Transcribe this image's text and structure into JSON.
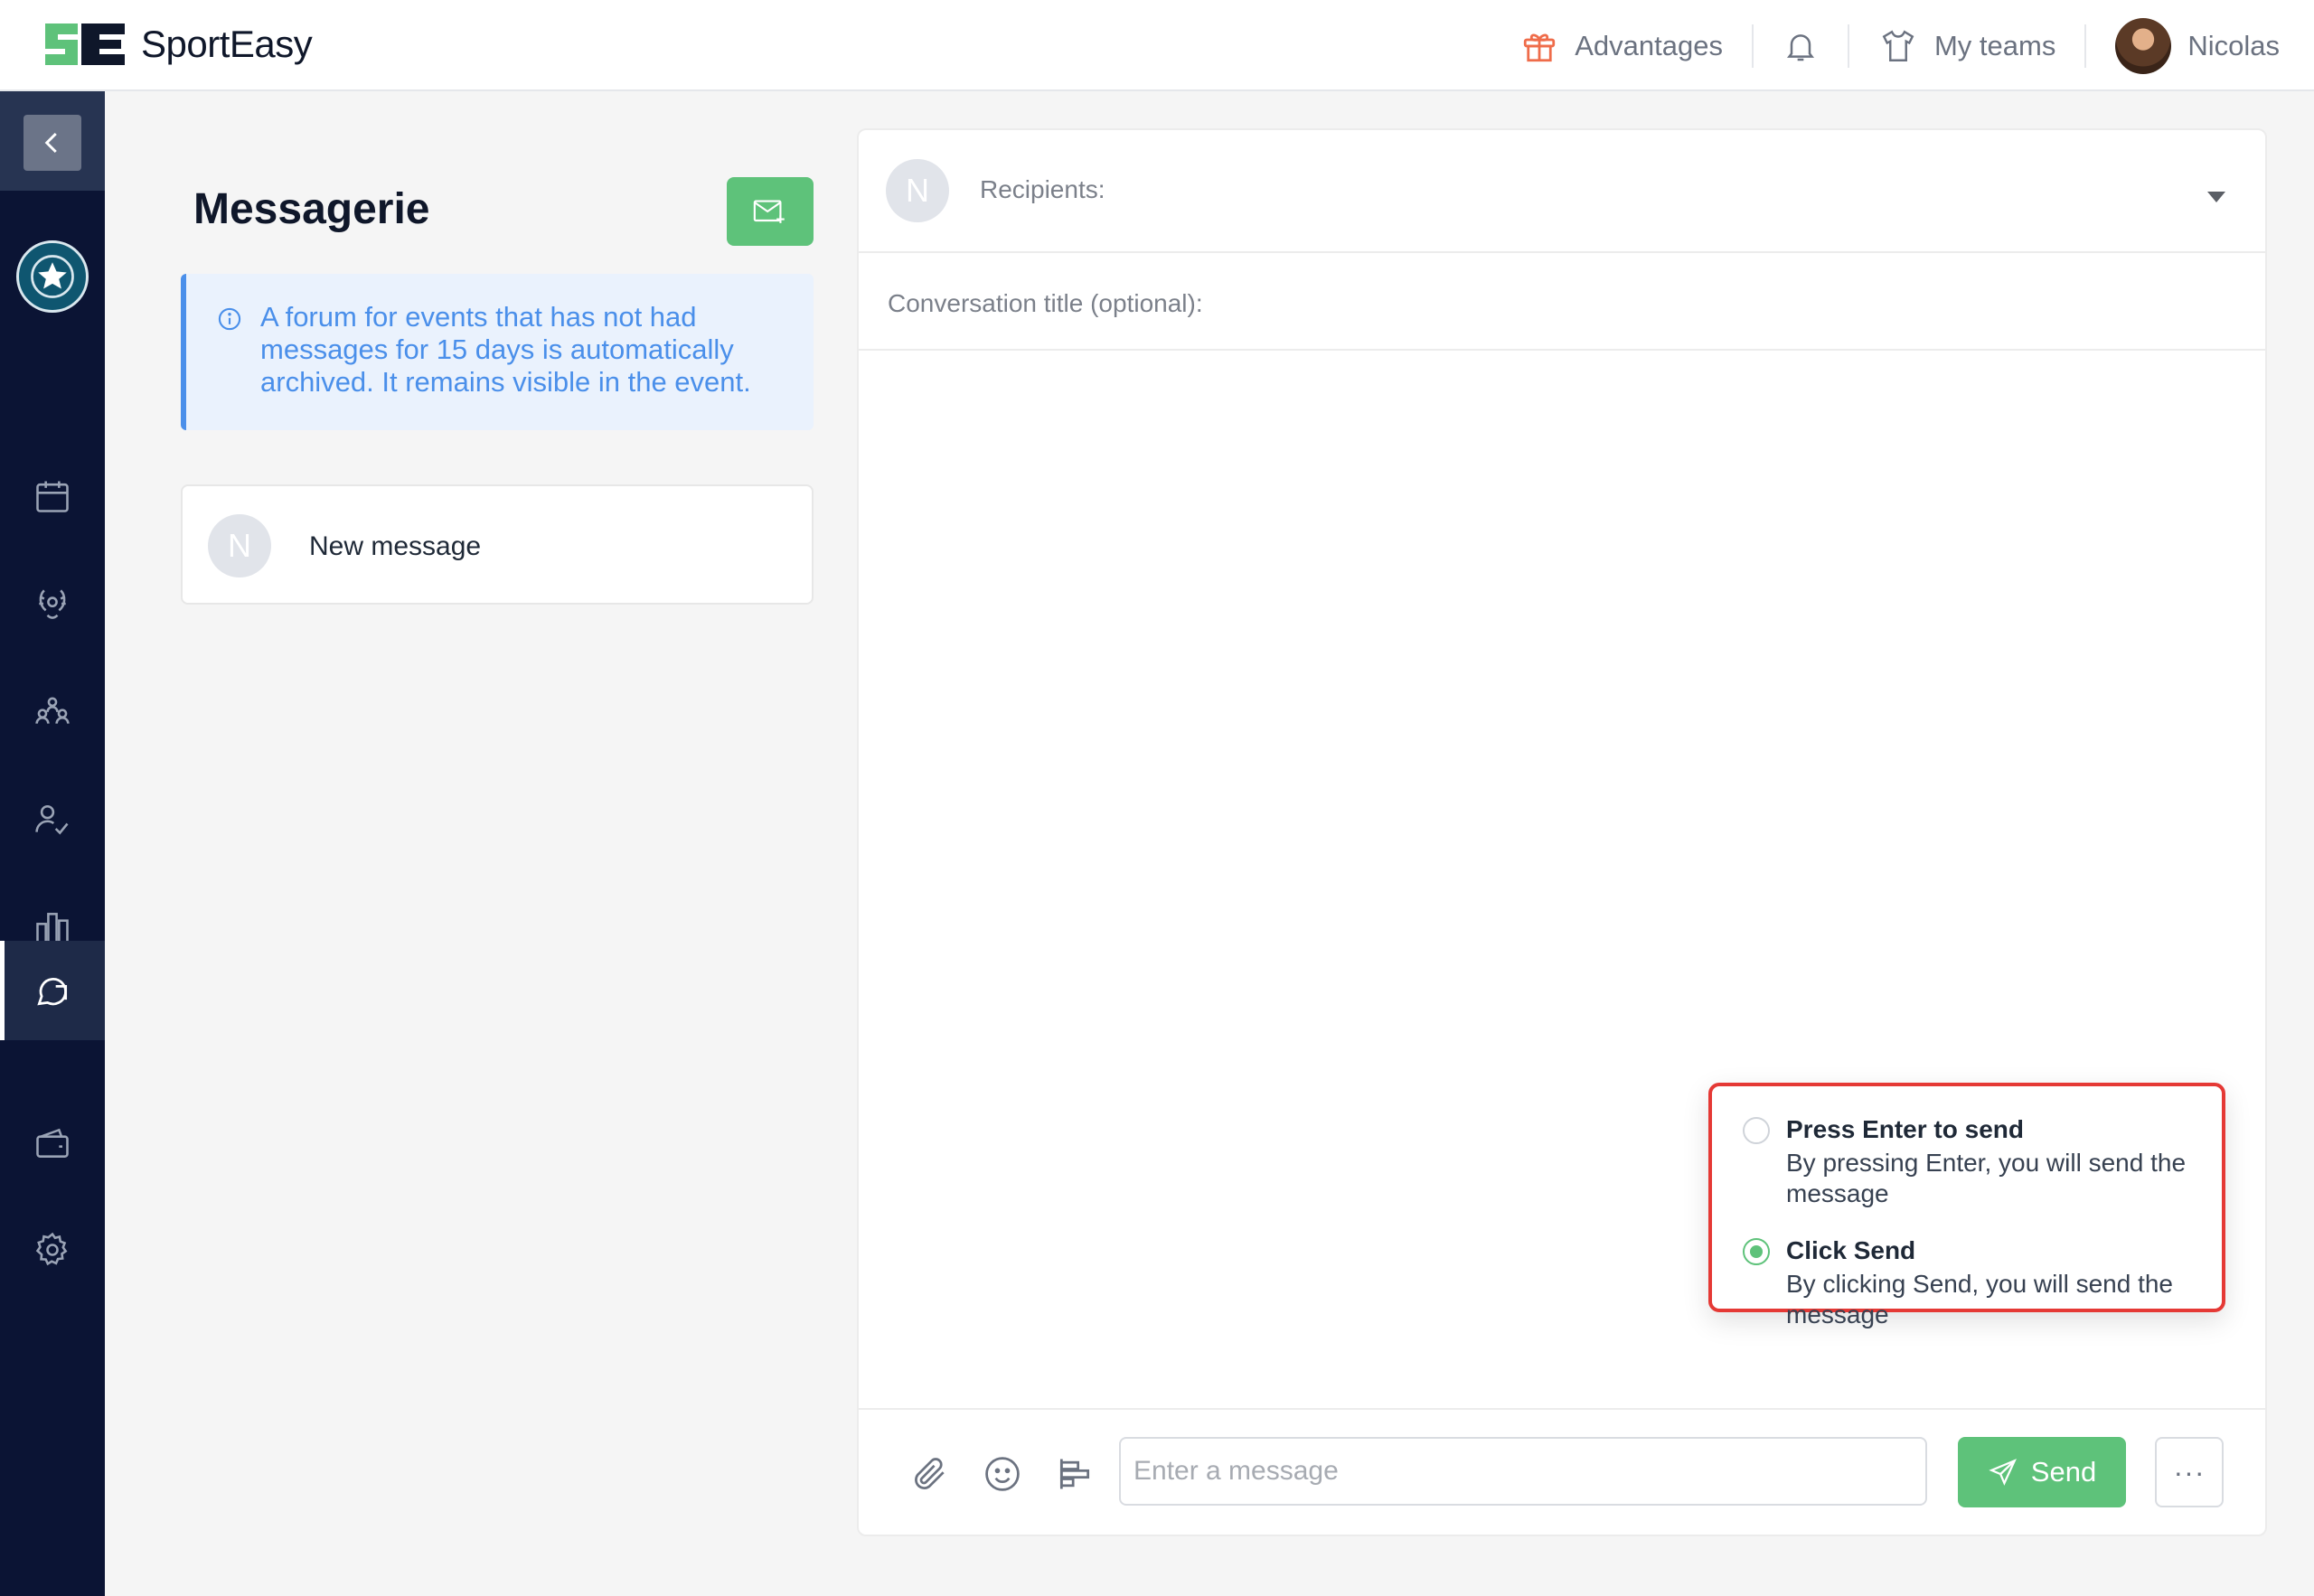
{
  "brand": {
    "name_part1": "Sport",
    "name_part2": "Easy",
    "logo_icon": "sporteasy-logo-icon"
  },
  "topbar": {
    "advantages_label": "Advantages",
    "my_teams_label": "My teams",
    "user_name": "Nicolas",
    "icons": [
      "gift-icon",
      "bell-icon",
      "tshirt-icon",
      "user-avatar"
    ]
  },
  "sidebar": {
    "items": [
      {
        "icon": "calendar-icon"
      },
      {
        "icon": "laurel-trophy-icon"
      },
      {
        "icon": "team-members-icon"
      },
      {
        "icon": "attendance-check-icon"
      },
      {
        "icon": "statistics-icon"
      },
      {
        "icon": "messages-icon",
        "active": true
      },
      {
        "icon": "wallet-icon"
      },
      {
        "icon": "settings-gear-icon"
      }
    ],
    "club_logo": "olympiens-club-logo"
  },
  "messaging": {
    "title": "Messagerie",
    "info_text": "A forum for events that has not had messages for 15 days is automatically archived. It remains visible in the event.",
    "conversation": {
      "avatar_initial": "N",
      "label": "New message"
    }
  },
  "chat": {
    "avatar_initial": "N",
    "recipients_label": "Recipients:",
    "title_label": "Conversation title (optional):",
    "send_options": [
      {
        "title": "Press Enter to send",
        "description": "By pressing Enter, you will send the message",
        "selected": false
      },
      {
        "title": "Click Send",
        "description": "By clicking Send, you will send the message",
        "selected": true
      }
    ],
    "composer": {
      "placeholder": "Enter a message",
      "send_label": "Send",
      "more_label": "···"
    }
  },
  "colors": {
    "accent_green": "#5ec27a",
    "sidebar_bg": "#0b1434",
    "info_blue": "#4a8fea",
    "highlight_red": "#e53935"
  }
}
